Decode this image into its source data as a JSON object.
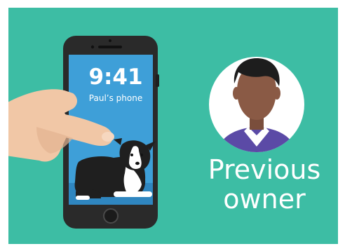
{
  "colors": {
    "background": "#3dbda4",
    "screen": "#3e9fd8",
    "phone_body": "#2a2a2a",
    "skin": "#f1c7a6",
    "avatar_circle": "#ffffff",
    "avatar_skin": "#8a5a45",
    "avatar_hair": "#1d1d1d",
    "avatar_shirt": "#5b4aa6",
    "text": "#ffffff"
  },
  "phone": {
    "time": "9:41",
    "device_name": "Paul’s phone"
  },
  "caption": {
    "line1": "Previous",
    "line2": "owner"
  },
  "icons": {
    "avatar": "person-avatar-icon",
    "dog": "dog-illustration",
    "hand": "hand-illustration"
  }
}
